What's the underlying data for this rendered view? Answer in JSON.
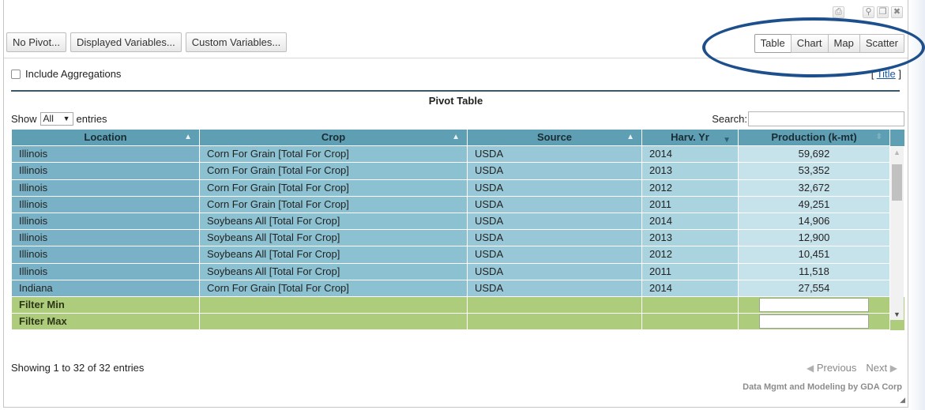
{
  "toolbar": {
    "buttons": [
      "No Pivot...",
      "Displayed Variables...",
      "Custom Variables..."
    ]
  },
  "views": {
    "buttons": [
      "Table",
      "Chart",
      "Map",
      "Scatter"
    ],
    "active": "Table"
  },
  "aggregations": {
    "label": "Include Aggregations",
    "checked": false
  },
  "title_link": {
    "prefix": "[ ",
    "label": "Title",
    "suffix": " ]"
  },
  "pivot": {
    "title": "Pivot Table"
  },
  "length": {
    "prefix": "Show",
    "value": "All",
    "suffix": "entries"
  },
  "search": {
    "label": "Search:",
    "value": ""
  },
  "table": {
    "columns": [
      "Location",
      "Crop",
      "Source",
      "Harv. Yr",
      "Production (k-mt)"
    ],
    "rows": [
      [
        "Illinois",
        "Corn For Grain [Total For Crop]",
        "USDA",
        "2014",
        "59,692"
      ],
      [
        "Illinois",
        "Corn For Grain [Total For Crop]",
        "USDA",
        "2013",
        "53,352"
      ],
      [
        "Illinois",
        "Corn For Grain [Total For Crop]",
        "USDA",
        "2012",
        "32,672"
      ],
      [
        "Illinois",
        "Corn For Grain [Total For Crop]",
        "USDA",
        "2011",
        "49,251"
      ],
      [
        "Illinois",
        "Soybeans All [Total For Crop]",
        "USDA",
        "2014",
        "14,906"
      ],
      [
        "Illinois",
        "Soybeans All [Total For Crop]",
        "USDA",
        "2013",
        "12,900"
      ],
      [
        "Illinois",
        "Soybeans All [Total For Crop]",
        "USDA",
        "2012",
        "10,451"
      ],
      [
        "Illinois",
        "Soybeans All [Total For Crop]",
        "USDA",
        "2011",
        "11,518"
      ],
      [
        "Indiana",
        "Corn For Grain [Total For Crop]",
        "USDA",
        "2014",
        "27,554"
      ]
    ],
    "filters": [
      "Filter Min",
      "Filter Max"
    ]
  },
  "info": "Showing 1 to 32 of 32 entries",
  "pager": {
    "previous": "Previous",
    "next": "Next"
  },
  "credit": "Data Mgmt and Modeling by GDA Corp",
  "colors": {
    "accent": "#1d4f8c",
    "header": "#5f9fb4",
    "filter_row": "#aecd7c",
    "link": "#1a56a8"
  }
}
